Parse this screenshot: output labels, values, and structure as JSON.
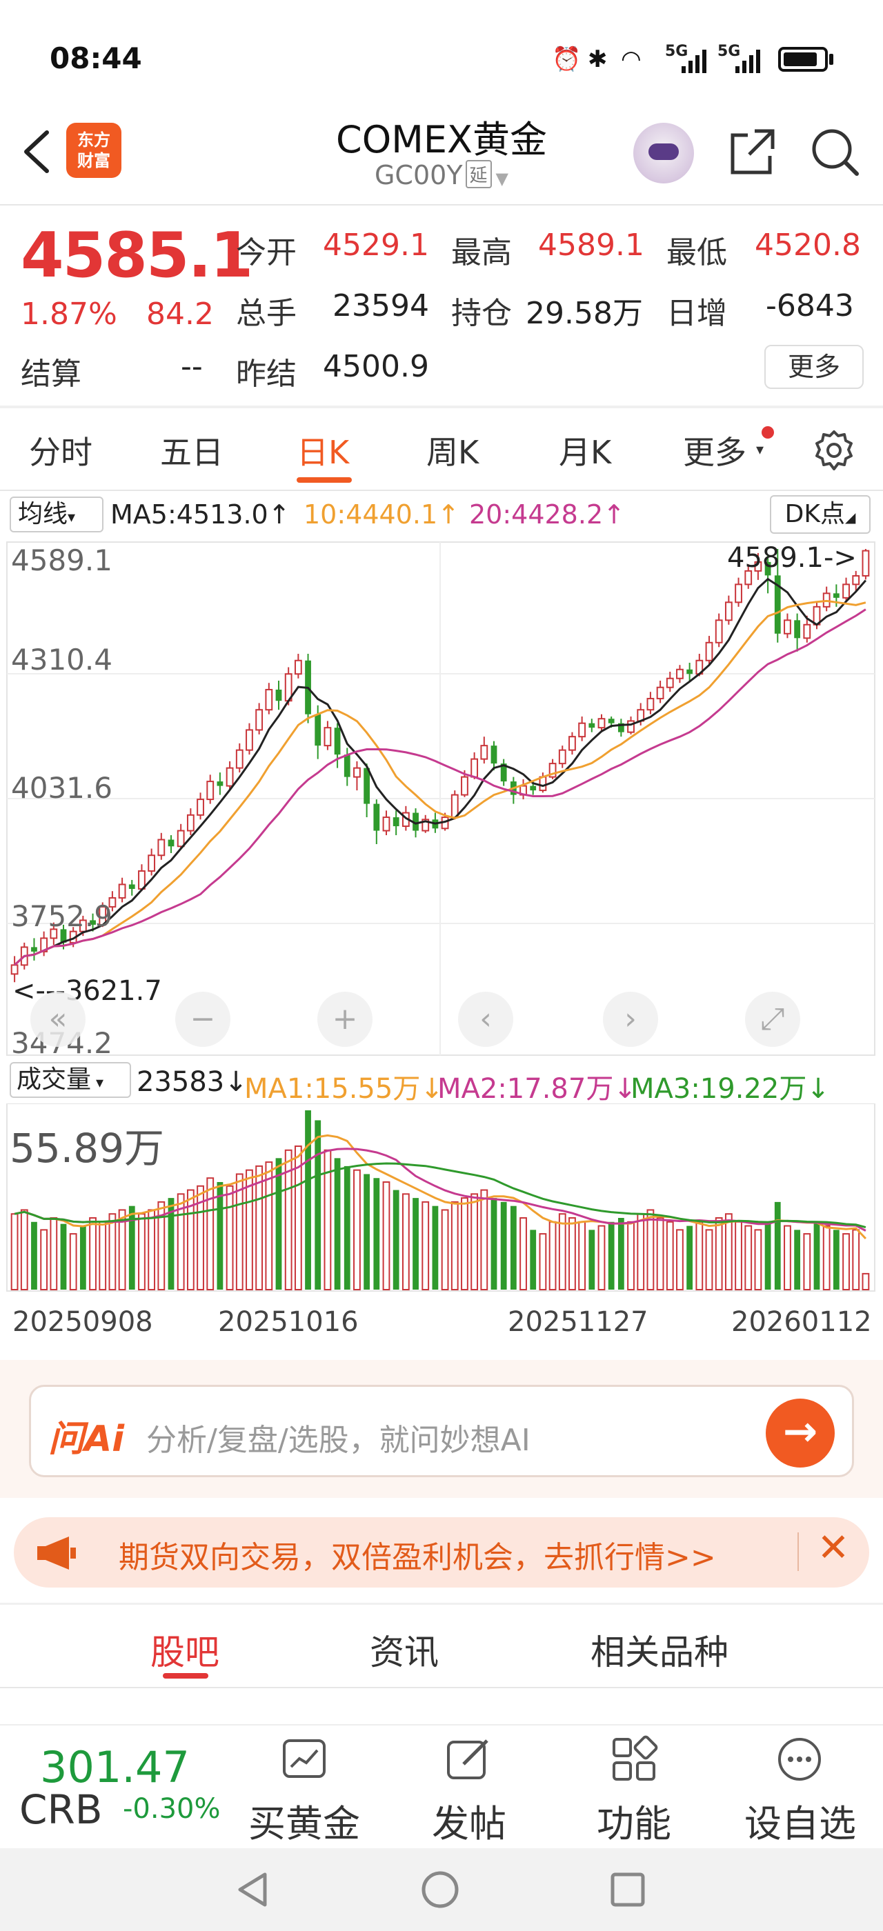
{
  "status_bar": {
    "time": "08:44",
    "network_labels": [
      "5G",
      "5G"
    ]
  },
  "header": {
    "back_icon": "chevron-left-icon",
    "logo_text": [
      "东方",
      "财富"
    ],
    "title": "COMEX黄金",
    "code": "GC00Y",
    "code_badge": "延",
    "icons": [
      "assistant-robot-icon",
      "share-icon",
      "search-icon"
    ]
  },
  "quote": {
    "price": "4585.1",
    "change_pct": "1.87%",
    "change_abs": "84.2",
    "open_label": "今开",
    "open": "4529.1",
    "high_label": "最高",
    "high": "4589.1",
    "low_label": "最低",
    "low": "4520.8",
    "volume_label": "总手",
    "volume": "23594",
    "oi_label": "持仓",
    "oi": "29.58万",
    "daily_inc_label": "日增",
    "daily_inc": "-6843",
    "settle_label": "结算",
    "settle": "--",
    "prev_settle_label": "昨结",
    "prev_settle": "4500.9",
    "more_label": "更多"
  },
  "period_tabs": {
    "items": [
      "分时",
      "五日",
      "日K",
      "周K",
      "月K",
      "更多"
    ],
    "active": "日K"
  },
  "ma_row": {
    "selector": "均线",
    "ma5": "MA5:4513.0↑",
    "ma10": "10:4440.1↑",
    "ma20": "20:4428.2↑",
    "dk_label": "DK点"
  },
  "kchart": {
    "y_labels": [
      "4589.1",
      "4310.4",
      "4031.6",
      "3752.9",
      "3474.2"
    ],
    "high_annotation": "4589.1->",
    "low_annotation": "<---3621.7",
    "colors": {
      "up": "#c9353a",
      "down": "#2f9a2c",
      "ma5": "#222222",
      "ma10": "#f0a030",
      "ma20": "#c53a8f"
    }
  },
  "chart_data": {
    "type": "candlestick",
    "y_range": [
      3474.2,
      4589.1
    ],
    "high": 4589.1,
    "low": 3621.7,
    "x_dates": [
      "20250908",
      "20251016",
      "20251127",
      "20260112"
    ],
    "candles": [
      [
        3640,
        3660,
        3621.7,
        3680
      ],
      [
        3660,
        3700,
        3650,
        3710
      ],
      [
        3700,
        3690,
        3670,
        3720
      ],
      [
        3690,
        3720,
        3680,
        3735
      ],
      [
        3720,
        3740,
        3705,
        3755
      ],
      [
        3740,
        3710,
        3695,
        3750
      ],
      [
        3710,
        3735,
        3700,
        3745
      ],
      [
        3735,
        3760,
        3725,
        3770
      ],
      [
        3760,
        3750,
        3735,
        3775
      ],
      [
        3750,
        3790,
        3745,
        3800
      ],
      [
        3790,
        3810,
        3780,
        3825
      ],
      [
        3810,
        3840,
        3800,
        3855
      ],
      [
        3840,
        3830,
        3815,
        3850
      ],
      [
        3830,
        3870,
        3825,
        3885
      ],
      [
        3870,
        3905,
        3860,
        3920
      ],
      [
        3905,
        3940,
        3895,
        3955
      ],
      [
        3940,
        3925,
        3910,
        3950
      ],
      [
        3925,
        3960,
        3920,
        3975
      ],
      [
        3960,
        3995,
        3950,
        4010
      ],
      [
        3995,
        4030,
        3985,
        4045
      ],
      [
        4030,
        4070,
        4020,
        4085
      ],
      [
        4070,
        4060,
        4040,
        4090
      ],
      [
        4060,
        4100,
        4050,
        4115
      ],
      [
        4100,
        4140,
        4090,
        4155
      ],
      [
        4140,
        4185,
        4130,
        4200
      ],
      [
        4185,
        4230,
        4175,
        4245
      ],
      [
        4230,
        4275,
        4220,
        4290
      ],
      [
        4275,
        4250,
        4230,
        4295
      ],
      [
        4250,
        4310,
        4240,
        4325
      ],
      [
        4310,
        4340,
        4300,
        4355
      ],
      [
        4340,
        4220,
        4200,
        4355
      ],
      [
        4220,
        4150,
        4120,
        4240
      ],
      [
        4150,
        4190,
        4140,
        4205
      ],
      [
        4190,
        4130,
        4100,
        4200
      ],
      [
        4130,
        4080,
        4060,
        4145
      ],
      [
        4080,
        4100,
        4050,
        4115
      ],
      [
        4100,
        4020,
        3990,
        4110
      ],
      [
        4020,
        3960,
        3930,
        4030
      ],
      [
        3960,
        3990,
        3950,
        4005
      ],
      [
        3990,
        3970,
        3950,
        4005
      ],
      [
        3970,
        4000,
        3960,
        4015
      ],
      [
        4000,
        3960,
        3945,
        4010
      ],
      [
        3960,
        3985,
        3955,
        3995
      ],
      [
        3985,
        3965,
        3955,
        4000
      ],
      [
        3965,
        3990,
        3960,
        4000
      ],
      [
        3990,
        4040,
        3985,
        4050
      ],
      [
        4040,
        4080,
        4035,
        4095
      ],
      [
        4080,
        4120,
        4075,
        4135
      ],
      [
        4120,
        4150,
        4110,
        4170
      ],
      [
        4150,
        4110,
        4095,
        4160
      ],
      [
        4110,
        4070,
        4060,
        4120
      ],
      [
        4070,
        4040,
        4020,
        4080
      ],
      [
        4040,
        4060,
        4030,
        4075
      ],
      [
        4060,
        4050,
        4040,
        4070
      ],
      [
        4050,
        4080,
        4045,
        4090
      ],
      [
        4080,
        4110,
        4075,
        4120
      ],
      [
        4110,
        4140,
        4100,
        4150
      ],
      [
        4140,
        4170,
        4130,
        4180
      ],
      [
        4170,
        4200,
        4160,
        4215
      ],
      [
        4200,
        4190,
        4180,
        4210
      ],
      [
        4190,
        4210,
        4180,
        4220
      ],
      [
        4210,
        4200,
        4190,
        4215
      ],
      [
        4200,
        4180,
        4170,
        4210
      ],
      [
        4180,
        4205,
        4175,
        4215
      ],
      [
        4205,
        4230,
        4195,
        4245
      ],
      [
        4230,
        4255,
        4220,
        4270
      ],
      [
        4255,
        4280,
        4245,
        4295
      ],
      [
        4280,
        4300,
        4270,
        4315
      ],
      [
        4300,
        4320,
        4290,
        4330
      ],
      [
        4320,
        4310,
        4295,
        4335
      ],
      [
        4310,
        4340,
        4305,
        4355
      ],
      [
        4340,
        4380,
        4330,
        4395
      ],
      [
        4380,
        4430,
        4370,
        4445
      ],
      [
        4430,
        4470,
        4420,
        4485
      ],
      [
        4470,
        4510,
        4460,
        4525
      ],
      [
        4510,
        4540,
        4500,
        4555
      ],
      [
        4540,
        4560,
        4520,
        4580
      ],
      [
        4560,
        4530,
        4490,
        4575
      ],
      [
        4530,
        4400,
        4380,
        4589.1
      ],
      [
        4400,
        4430,
        4390,
        4445
      ],
      [
        4430,
        4390,
        4360,
        4445
      ],
      [
        4390,
        4420,
        4380,
        4440
      ],
      [
        4420,
        4460,
        4410,
        4470
      ],
      [
        4460,
        4490,
        4450,
        4505
      ],
      [
        4490,
        4480,
        4460,
        4510
      ],
      [
        4480,
        4510,
        4470,
        4525
      ],
      [
        4510,
        4529,
        4495,
        4540
      ],
      [
        4529.1,
        4585.1,
        4520.8,
        4589.1
      ]
    ],
    "volumes": [
      38,
      40,
      34,
      30,
      36,
      33,
      28,
      32,
      36,
      34,
      38,
      40,
      42,
      38,
      40,
      44,
      46,
      48,
      50,
      52,
      56,
      54,
      52,
      58,
      60,
      62,
      64,
      66,
      70,
      72,
      90,
      85,
      70,
      66,
      62,
      60,
      58,
      56,
      54,
      50,
      48,
      46,
      44,
      42,
      40,
      44,
      46,
      48,
      50,
      46,
      44,
      42,
      36,
      30,
      28,
      34,
      38,
      36,
      34,
      30,
      32,
      34,
      36,
      34,
      38,
      40,
      36,
      34,
      30,
      32,
      34,
      30,
      36,
      38,
      34,
      32,
      30,
      34,
      44,
      32,
      30,
      28,
      34,
      32,
      30,
      28,
      30,
      8
    ],
    "volume_colors_down": [
      2,
      5,
      7,
      12,
      16,
      21,
      27,
      30,
      31,
      33,
      34,
      36,
      37,
      39,
      41,
      43,
      49,
      50,
      51,
      53,
      59,
      61,
      62,
      69,
      77,
      78,
      80,
      82,
      84
    ],
    "ma_last": {
      "ma5": 4513.0,
      "ma10": 4440.1,
      "ma20": 4428.2
    }
  },
  "volume_row": {
    "selector": "成交量",
    "current": "23583↓",
    "ma1": "MA1:15.55万↓",
    "ma2": "MA2:17.87万↓",
    "ma3": "MA3:19.22万↓",
    "max_label": "55.89万"
  },
  "dates": [
    "20250908",
    "20251016",
    "20251127",
    "20260112"
  ],
  "ai": {
    "logo": "问Ai",
    "placeholder": "分析/复盘/选股，就问妙想AI"
  },
  "promo": {
    "text": "期货双向交易，双倍盈利机会，去抓行情>>"
  },
  "community_tabs": {
    "items": [
      "股吧",
      "资讯",
      "相关品种"
    ],
    "active": "股吧"
  },
  "bottom_bar": {
    "ticker_price": "301.47",
    "ticker_name": "CRB",
    "ticker_pct": "-0.30%",
    "items": [
      "买黄金",
      "发帖",
      "功能",
      "设自选"
    ]
  }
}
